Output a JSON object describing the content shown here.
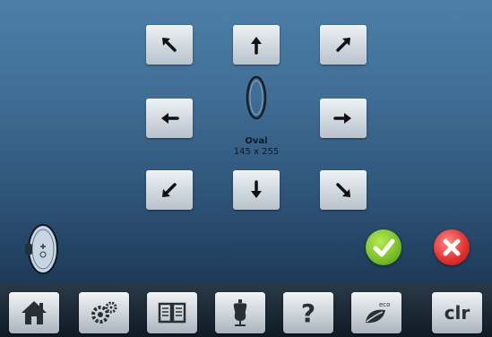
{
  "hoop": {
    "name": "Oval",
    "size": "145 x 255"
  },
  "move_buttons": [
    {
      "direction": "up-left",
      "icon": "arrow-up-left-icon"
    },
    {
      "direction": "up",
      "icon": "arrow-up-icon"
    },
    {
      "direction": "up-right",
      "icon": "arrow-up-right-icon"
    },
    {
      "direction": "left",
      "icon": "arrow-left-icon"
    },
    {
      "direction": "right",
      "icon": "arrow-right-icon"
    },
    {
      "direction": "down-left",
      "icon": "arrow-down-left-icon"
    },
    {
      "direction": "down",
      "icon": "arrow-down-icon"
    },
    {
      "direction": "down-right",
      "icon": "arrow-down-right-icon"
    }
  ],
  "actions": {
    "confirm_icon": "checkmark-icon",
    "cancel_icon": "x-icon"
  },
  "taskbar": {
    "home_icon": "home-icon",
    "setup_icon": "gears-icon",
    "tutorial_icon": "book-icon",
    "consultant_icon": "dress-form-icon",
    "help_label": "?",
    "eco_label": "eco",
    "clr_label": "clr"
  },
  "colors": {
    "confirm": "#7cc32a",
    "cancel": "#e8332f",
    "screen_top": "#4d7fa8",
    "screen_bottom": "#1d3a57"
  }
}
